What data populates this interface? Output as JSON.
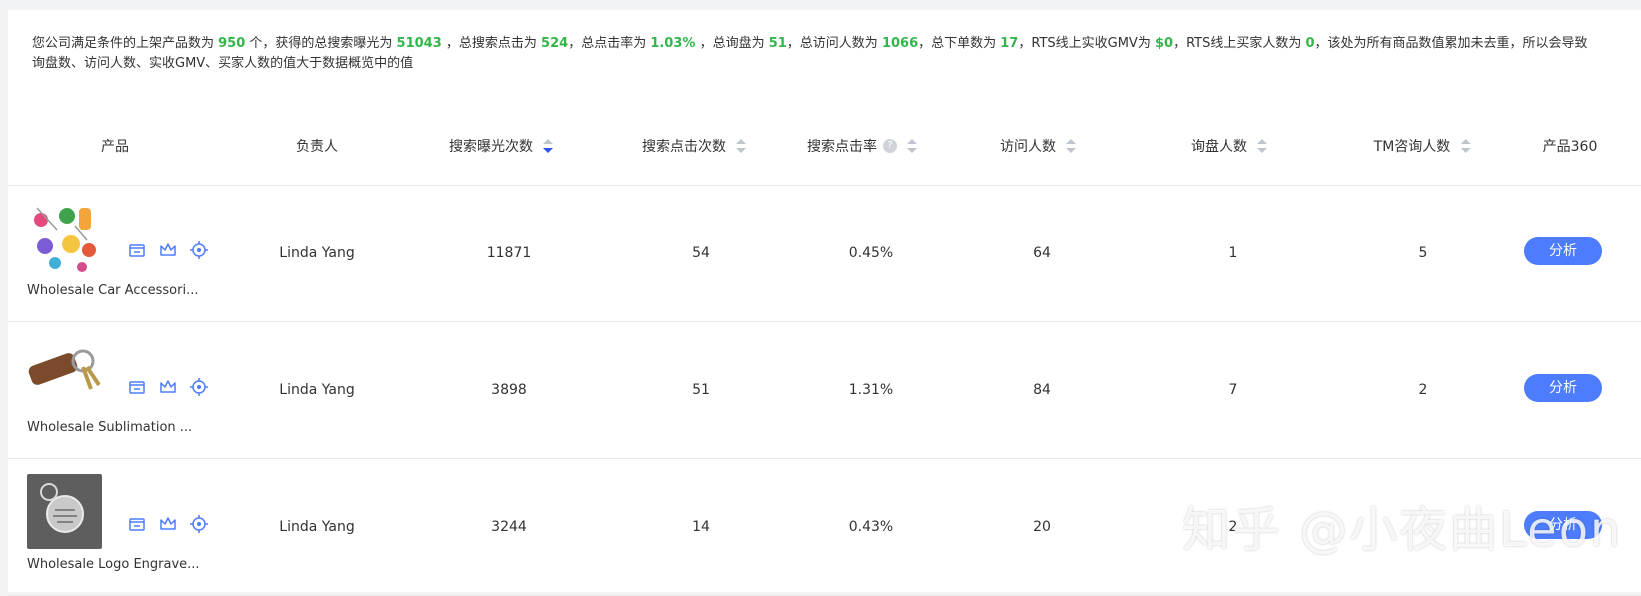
{
  "summary": {
    "t1": "您公司满足条件的上架产品数为 ",
    "products": "950",
    "t2": " 个，获得的总搜索曝光为 ",
    "exposure": "51043",
    "t3": " ，总搜索点击为 ",
    "clicks": "524",
    "t4": "，总点击率为 ",
    "ctr": "1.03%",
    "t5": " ，总询盘为 ",
    "inquiries": "51",
    "t6": "，总访问人数为 ",
    "visitors": "1066",
    "t7": "，总下单数为 ",
    "orders": "17",
    "t8": "，RTS线上实收GMV为 ",
    "gmv": "$0",
    "t9": "，RTS线上买家人数为 ",
    "buyers": "0",
    "t10": "，该处为所有商品数值累加未去重，所以会导致询盘数、访问人数、实收GMV、买家人数的值大于数据概览中的值"
  },
  "columns": {
    "product": "产品",
    "owner": "负责人",
    "exposure": "搜索曝光次数",
    "clicks": "搜索点击次数",
    "ctr": "搜索点击率",
    "visitors": "访问人数",
    "inquirers": "询盘人数",
    "tm": "TM咨询人数",
    "p360": "产品360"
  },
  "rows": [
    {
      "name": "Wholesale Car Accessori...",
      "owner": "Linda Yang",
      "exposure": "11871",
      "clicks": "54",
      "ctr": "0.45%",
      "visitors": "64",
      "inquirers": "1",
      "tm": "5",
      "action": "分析"
    },
    {
      "name": "Wholesale Sublimation ...",
      "owner": "Linda Yang",
      "exposure": "3898",
      "clicks": "51",
      "ctr": "1.31%",
      "visitors": "84",
      "inquirers": "7",
      "tm": "2",
      "action": "分析"
    },
    {
      "name": "Wholesale Logo Engrave...",
      "owner": "Linda Yang",
      "exposure": "3244",
      "clicks": "14",
      "ctr": "0.43%",
      "visitors": "20",
      "inquirers": "2",
      "tm": "",
      "action": "分析"
    }
  ],
  "watermark": "知乎 @小夜曲Leon",
  "icons": [
    "store-icon",
    "crown-icon",
    "target-icon"
  ],
  "colors": {
    "highlight": "#32b64a",
    "accent": "#4d7cfe",
    "sort_active": "#2f54eb"
  }
}
